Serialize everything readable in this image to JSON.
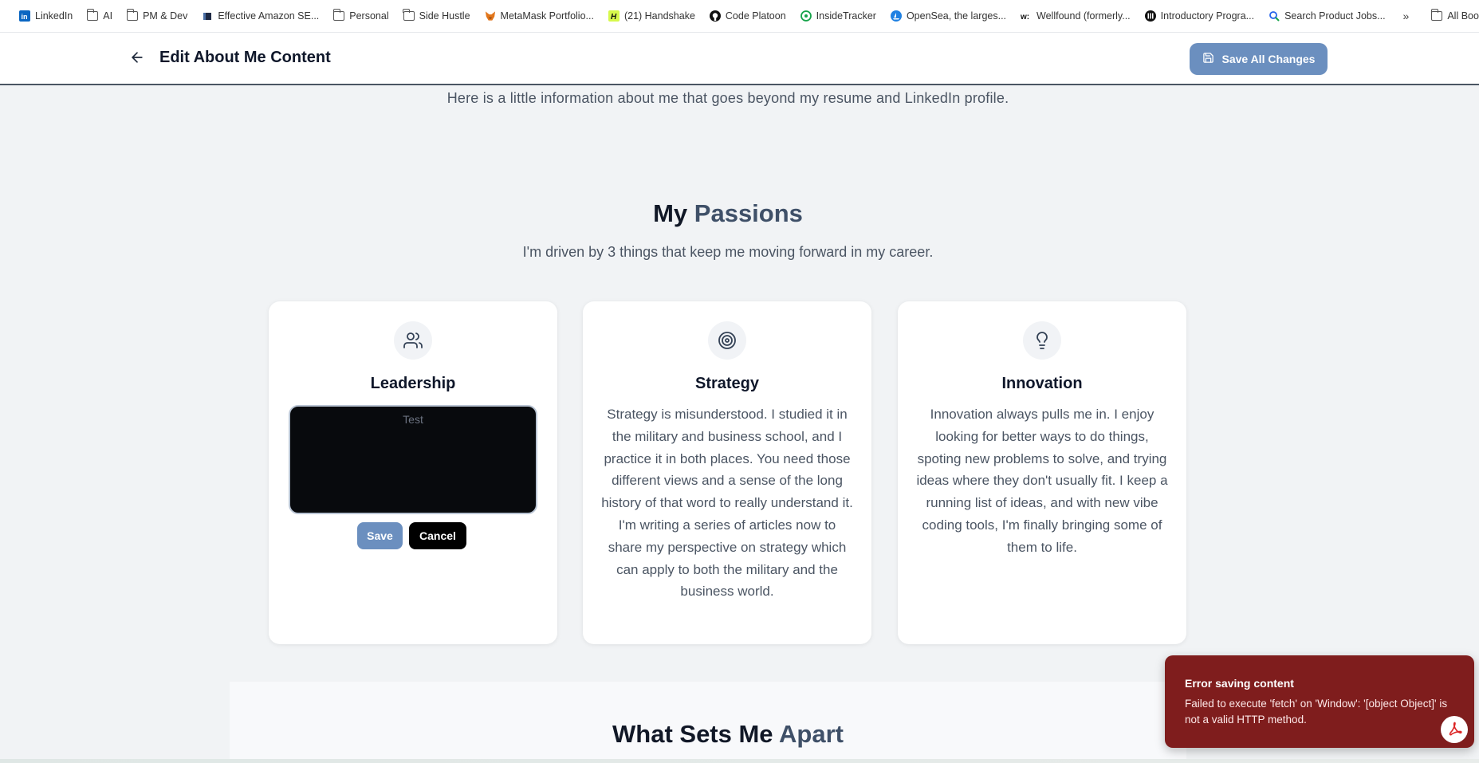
{
  "bookmarks": [
    {
      "label": "LinkedIn",
      "icon": "linkedin-icon"
    },
    {
      "label": "AI",
      "icon": "folder-icon"
    },
    {
      "label": "PM & Dev",
      "icon": "folder-icon"
    },
    {
      "label": "Effective Amazon SE...",
      "icon": "amazon-icon"
    },
    {
      "label": "Personal",
      "icon": "folder-icon"
    },
    {
      "label": "Side Hustle",
      "icon": "folder-icon"
    },
    {
      "label": "MetaMask Portfolio...",
      "icon": "metamask-icon"
    },
    {
      "label": "(21) Handshake",
      "icon": "handshake-icon"
    },
    {
      "label": "Code Platoon",
      "icon": "github-icon"
    },
    {
      "label": "InsideTracker",
      "icon": "insidetracker-icon"
    },
    {
      "label": "OpenSea, the larges...",
      "icon": "opensea-icon"
    },
    {
      "label": "Wellfound (formerly...",
      "icon": "wellfound-icon"
    },
    {
      "label": "Introductory Progra...",
      "icon": "program-icon"
    },
    {
      "label": "Search Product Jobs...",
      "icon": "jobs-icon"
    }
  ],
  "bookmarks_all": "All Bookmarks",
  "header": {
    "title": "Edit About Me Content",
    "save_all_label": "Save All Changes"
  },
  "intro": "Here is a little information about me that goes beyond my resume and LinkedIn profile.",
  "passions": {
    "title_plain": "My",
    "title_accent": "Passions",
    "subtitle": "I'm driven by 3 things that keep me moving forward in my career.",
    "cards": [
      {
        "title": "Leadership",
        "icon": "users-icon",
        "editor_value": "Test",
        "save_label": "Save",
        "cancel_label": "Cancel"
      },
      {
        "title": "Strategy",
        "icon": "target-icon",
        "text": "Strategy is misunderstood. I studied it in the military and business school, and I practice it in both places. You need those different views and a sense of the long history of that word to really understand it. I'm writing a series of articles now to share my perspective on strategy which can apply to both the military and the business world."
      },
      {
        "title": "Innovation",
        "icon": "lightbulb-icon",
        "text": "Innovation always pulls me in. I enjoy looking for better ways to do things, spoting new problems to solve, and trying ideas where they don't usually fit. I keep a running list of ideas, and with new vibe coding tools, I'm finally bringing some of them to life."
      }
    ]
  },
  "apart": {
    "title_plain": "What Sets Me",
    "title_accent": "Apart"
  },
  "toast": {
    "title": "Error saving content",
    "message": "Failed to execute 'fetch' on 'Window': '[object Object]' is not a valid HTTP method."
  },
  "colors": {
    "accent_button": "#6b8fbf",
    "title_accent": "#3f5068",
    "toast_bg": "#7f1d1d"
  }
}
